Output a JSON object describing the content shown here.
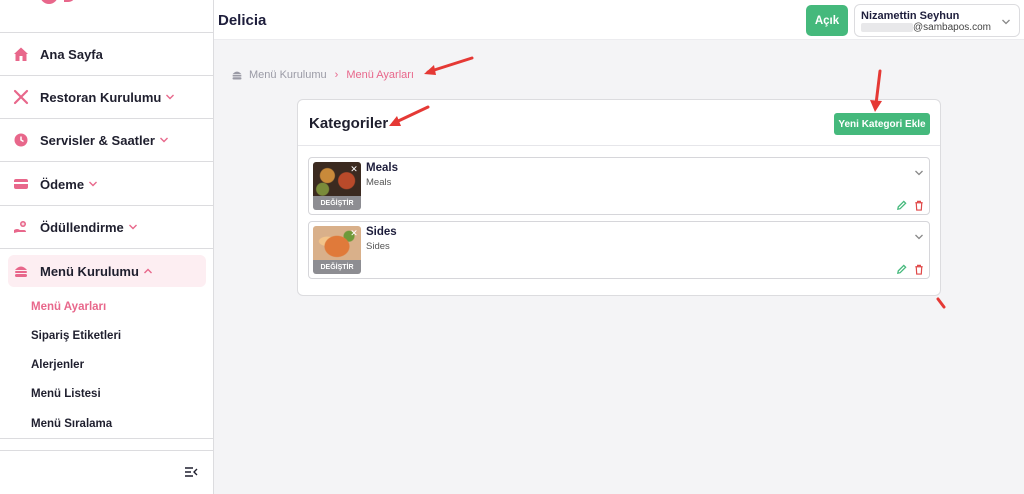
{
  "app": {
    "title": "Delicia"
  },
  "header": {
    "status_button": "Açık",
    "user": {
      "name": "Nizamettin Seyhun",
      "email": "@sambapos.com"
    }
  },
  "sidebar": {
    "items": [
      {
        "label": "Ana Sayfa",
        "icon": "home-icon"
      },
      {
        "label": "Restoran Kurulumu",
        "icon": "utensils-icon"
      },
      {
        "label": "Servisler & Saatler",
        "icon": "clock-icon"
      },
      {
        "label": "Ödeme",
        "icon": "credit-card-icon"
      },
      {
        "label": "Ödüllendirme",
        "icon": "reward-icon"
      },
      {
        "label": "Menü Kurulumu",
        "icon": "burger-icon"
      }
    ],
    "sub_items": [
      {
        "label": "Menü Ayarları"
      },
      {
        "label": "Sipariş Etiketleri"
      },
      {
        "label": "Alerjenler"
      },
      {
        "label": "Menü Listesi"
      },
      {
        "label": "Menü Sıralama"
      }
    ]
  },
  "breadcrumb": {
    "parent": "Menü Kurulumu",
    "separator": "›",
    "current": "Menü Ayarları"
  },
  "categories_card": {
    "title": "Kategoriler",
    "add_button": "Yeni Kategori Ekle",
    "items": [
      {
        "name": "Meals",
        "description": "Meals",
        "change_label": "DEĞİŞTİR",
        "remove_glyph": "✕"
      },
      {
        "name": "Sides",
        "description": "Sides",
        "change_label": "DEĞİŞTİR",
        "remove_glyph": "✕"
      }
    ]
  },
  "colors": {
    "accent_pink": "#e8678b",
    "success_green": "#45b97c",
    "delete_red": "#e04848",
    "annotation_red": "#e53935"
  }
}
